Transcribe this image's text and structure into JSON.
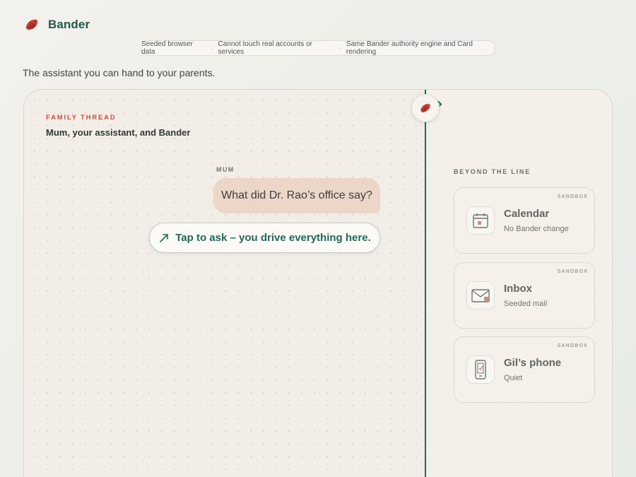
{
  "app": {
    "name": "Bander",
    "logo_icon": "bird-logo-icon"
  },
  "notice": {
    "items": [
      "Seeded browser data",
      "Cannot touch real accounts or services",
      "Same Bander authority engine and Card rendering"
    ],
    "separator": "·"
  },
  "tagline": "The assistant you can hand to your parents.",
  "thread": {
    "eyebrow": "FAMILY THREAD",
    "title": "Mum, your assistant, and Bander",
    "message": {
      "sender": "MUM",
      "text": "What did Dr. Rao’s office say?"
    },
    "ask_button": {
      "icon": "arrow-up-right-icon",
      "label": "Tap to ask – you drive everything here."
    }
  },
  "beyond": {
    "heading": "BEYOND THE LINE",
    "cards": [
      {
        "tag": "SANDBOX",
        "title": "Calendar",
        "subtitle": "No Bander change",
        "icon": "calendar-icon"
      },
      {
        "tag": "SANDBOX",
        "title": "Inbox",
        "subtitle": "Seeded mail",
        "icon": "mail-icon"
      },
      {
        "tag": "SANDBOX",
        "title": "Gil’s phone",
        "subtitle": "Quiet",
        "icon": "phone-icon"
      }
    ]
  },
  "colors": {
    "accent": "#1f6b5b",
    "eyebrow": "#d24d3a",
    "bubble": "#ecd6c7",
    "logo": "#c9423a"
  }
}
